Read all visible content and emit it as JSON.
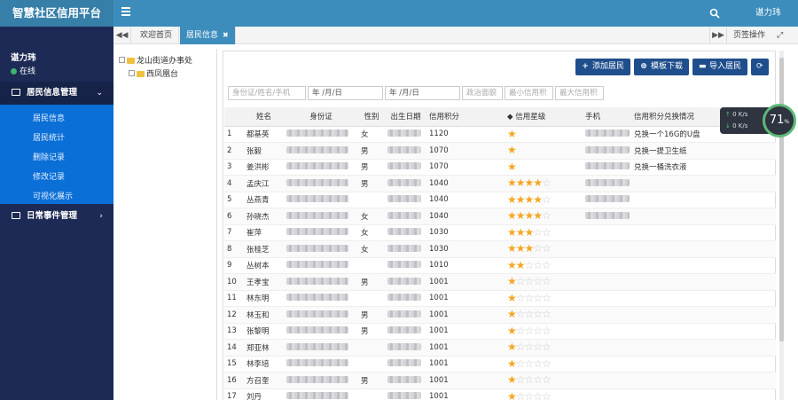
{
  "app": {
    "title": "智慧社区信用平台",
    "user": "谌力玮"
  },
  "sidebar": {
    "user_name": "谌力玮",
    "status": "在线",
    "menu": [
      {
        "label": "居民信息管理",
        "icon": "monitor-icon",
        "expanded": true,
        "items": [
          "居民信息",
          "居民统计",
          "删除记录",
          "修改记录",
          "可视化展示"
        ]
      },
      {
        "label": "日常事件管理",
        "icon": "monitor-icon",
        "expanded": false
      }
    ]
  },
  "tabs": {
    "items": [
      {
        "label": "欢迎首页",
        "active": false
      },
      {
        "label": "居民信息",
        "active": true
      }
    ],
    "right_action": "页签操作"
  },
  "tree": {
    "root": "龙山街道办事处",
    "child": "西凤凰台"
  },
  "toolbar": {
    "add": "添加居民",
    "template": "模板下载",
    "import": "导入居民"
  },
  "filters": {
    "search_placeholder": "身份证/姓名/手机",
    "date1": "年 /月/日",
    "date2": "年 /月/日",
    "politics": "政治面貌",
    "min_credit": "最小信用积",
    "max_credit": "最大信用积"
  },
  "table": {
    "headers": [
      "",
      "姓名",
      "身份证",
      "性别",
      "出生日期",
      "信用积分",
      "信用星级",
      "手机",
      "信用积分兑换情况"
    ],
    "rows": [
      {
        "no": "1",
        "name": "都基英",
        "gender": "女",
        "credit": "1120",
        "stars": 1,
        "exchange": "兑换一个16G的U盘"
      },
      {
        "no": "2",
        "name": "张毅",
        "gender": "男",
        "credit": "1070",
        "stars": 1,
        "exchange": "兑换一提卫生纸"
      },
      {
        "no": "3",
        "name": "姜洪彬",
        "gender": "男",
        "credit": "1070",
        "stars": 1,
        "exchange": "兑换一桶洗衣液"
      },
      {
        "no": "4",
        "name": "孟庆江",
        "gender": "男",
        "credit": "1040",
        "stars": 4,
        "exchange": ""
      },
      {
        "no": "5",
        "name": "丛燕青",
        "gender": "",
        "credit": "1040",
        "stars": 4,
        "exchange": ""
      },
      {
        "no": "6",
        "name": "孙晓杰",
        "gender": "女",
        "credit": "1040",
        "stars": 4,
        "exchange": ""
      },
      {
        "no": "7",
        "name": "崔萍",
        "gender": "女",
        "credit": "1030",
        "stars": 3,
        "exchange": ""
      },
      {
        "no": "8",
        "name": "张桂芝",
        "gender": "女",
        "credit": "1030",
        "stars": 3,
        "exchange": ""
      },
      {
        "no": "9",
        "name": "丛树本",
        "gender": "",
        "credit": "1010",
        "stars": 2,
        "exchange": ""
      },
      {
        "no": "10",
        "name": "王孝宝",
        "gender": "男",
        "credit": "1001",
        "stars": 1,
        "exchange": ""
      },
      {
        "no": "11",
        "name": "林东明",
        "gender": "",
        "credit": "1001",
        "stars": 1,
        "exchange": ""
      },
      {
        "no": "12",
        "name": "林玉和",
        "gender": "男",
        "credit": "1001",
        "stars": 1,
        "exchange": ""
      },
      {
        "no": "13",
        "name": "张黎明",
        "gender": "男",
        "credit": "1001",
        "stars": 1,
        "exchange": ""
      },
      {
        "no": "14",
        "name": "郑亚林",
        "gender": "",
        "credit": "1001",
        "stars": 1,
        "exchange": ""
      },
      {
        "no": "15",
        "name": "林李培",
        "gender": "",
        "credit": "1001",
        "stars": 1,
        "exchange": ""
      },
      {
        "no": "16",
        "name": "方召奎",
        "gender": "男",
        "credit": "1001",
        "stars": 1,
        "exchange": ""
      },
      {
        "no": "17",
        "name": "刘丹",
        "gender": "",
        "credit": "1001",
        "stars": 1,
        "exchange": ""
      }
    ]
  },
  "net_widget": {
    "up": "0 K/s",
    "down": "0 K/s",
    "percent": "71",
    "unit": "%"
  },
  "colors": {
    "topbar": "#3c8dbc",
    "sidebar": "#1d2a55",
    "submenu": "#0a6fd6",
    "button": "#1f4e8c",
    "star": "#f5a623"
  }
}
